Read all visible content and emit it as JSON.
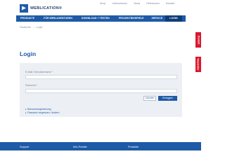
{
  "topnav": [
    "Shop",
    "Unternehmen",
    "News",
    "Referenzen",
    "Kontakt"
  ],
  "logo": {
    "text": "WEBLICATION®"
  },
  "mainnav": [
    {
      "label": "PRODUKTE"
    },
    {
      "label": "FÜR WEB-AGENTUREN"
    },
    {
      "label": "DOWNLOAD + TESTEN"
    },
    {
      "label": "PROJEKTBEISPIELE"
    },
    {
      "label": "SERVICE"
    },
    {
      "label": "LOGIN"
    }
  ],
  "breadcrumb": {
    "home": "Startseite",
    "current": "Login"
  },
  "side_tabs": [
    "Kontakt",
    "Newsletter"
  ],
  "page": {
    "title": "Login"
  },
  "form": {
    "username_label": "E-Mail / Benutzername *",
    "password_label": "Passwort *",
    "reset_label": "Löschen",
    "login_label": "Einloggen",
    "register_link": "Benutzerregistrierung",
    "forgot_link": "Passwort vergessen / ändern"
  },
  "footer": [
    "Support",
    "Info-Portale",
    "Produkte"
  ]
}
